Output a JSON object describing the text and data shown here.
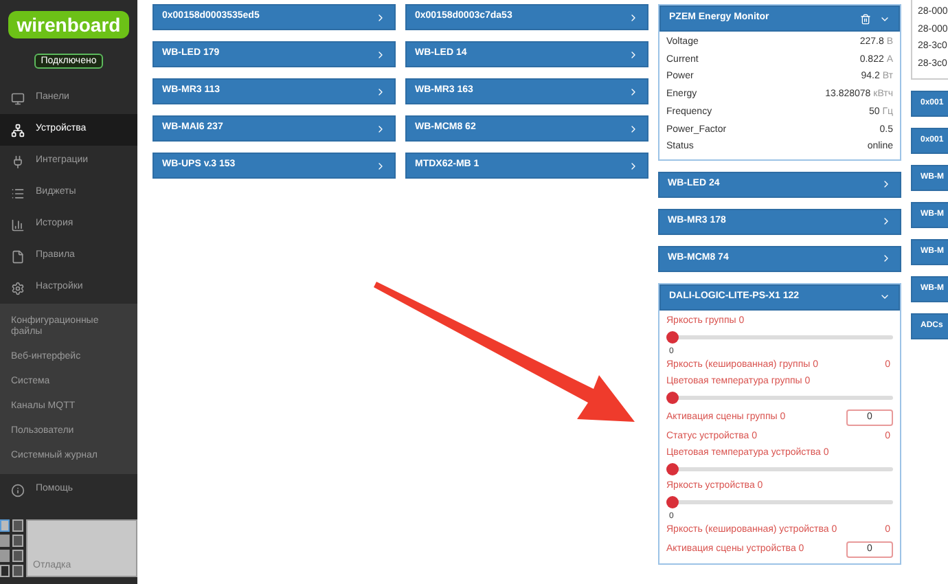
{
  "sidebar": {
    "logo": "wirenboard",
    "status": "Подключено",
    "items": [
      {
        "label": "Панели",
        "selected": false
      },
      {
        "label": "Устройства",
        "selected": true
      },
      {
        "label": "Интеграции",
        "selected": false
      },
      {
        "label": "Виджеты",
        "selected": false
      },
      {
        "label": "История",
        "selected": false
      },
      {
        "label": "Правила",
        "selected": false
      },
      {
        "label": "Настройки",
        "selected": false,
        "expanded": true,
        "children": [
          "Конфигурационные файлы",
          "Веб-интерфейс",
          "Система",
          "Каналы MQTT",
          "Пользователи",
          "Системный журнал"
        ]
      },
      {
        "label": "Помощь",
        "selected": false
      }
    ],
    "snap_label": "Отладка"
  },
  "columns": [
    {
      "devices": [
        {
          "title": "0x00158d0003535ed5",
          "expanded": false
        },
        {
          "title": "WB-LED 179",
          "expanded": false
        },
        {
          "title": "WB-MR3 113",
          "expanded": false
        },
        {
          "title": "WB-MAI6 237",
          "expanded": false
        },
        {
          "title": "WB-UPS v.3 153",
          "expanded": false
        }
      ]
    },
    {
      "devices": [
        {
          "title": "0x00158d0003c7da53",
          "expanded": false
        },
        {
          "title": "WB-LED 14",
          "expanded": false
        },
        {
          "title": "WB-MR3 163",
          "expanded": false
        },
        {
          "title": "WB-MCM8 62",
          "expanded": false
        },
        {
          "title": "MTDX62-MB 1",
          "expanded": false
        }
      ]
    },
    {
      "devices": [
        {
          "title": "PZEM Energy Monitor",
          "expanded": true,
          "deletable": true,
          "controls": [
            {
              "kind": "reading",
              "label": "Voltage",
              "value": "227.8",
              "unit": "В"
            },
            {
              "kind": "reading",
              "label": "Current",
              "value": "0.822",
              "unit": "А"
            },
            {
              "kind": "reading",
              "label": "Power",
              "value": "94.2",
              "unit": "Вт"
            },
            {
              "kind": "reading",
              "label": "Energy",
              "value": "13.828078",
              "unit": "кВтч"
            },
            {
              "kind": "reading",
              "label": "Frequency",
              "value": "50",
              "unit": "Гц"
            },
            {
              "kind": "reading",
              "label": "Power_Factor",
              "value": "0.5"
            },
            {
              "kind": "reading",
              "label": "Status",
              "value": "online"
            }
          ]
        },
        {
          "title": "WB-LED 24",
          "expanded": false
        },
        {
          "title": "WB-MR3 178",
          "expanded": false
        },
        {
          "title": "WB-MCM8 74",
          "expanded": false
        },
        {
          "title": "DALI-LOGIC-LITE-PS-X1 122",
          "expanded": true,
          "deletable": false,
          "controls": [
            {
              "kind": "slider",
              "label": "Яркость группы 0",
              "level": 0,
              "reading": "0"
            },
            {
              "kind": "value",
              "label": "Яркость (кешированная) группы 0",
              "value": "0"
            },
            {
              "kind": "slider",
              "label": "Цветовая температура группы 0",
              "level": 0
            },
            {
              "kind": "input",
              "label": "Активация сцены группы 0",
              "value": "0"
            },
            {
              "kind": "value",
              "label": "Статус устройства 0",
              "value": "0"
            },
            {
              "kind": "slider",
              "label": "Цветовая температура устройства 0",
              "level": 0
            },
            {
              "kind": "slider",
              "label": "Яркость устройства 0",
              "level": 0,
              "reading": "0"
            },
            {
              "kind": "value",
              "label": "Яркость (кешированная) устройства 0",
              "value": "0"
            },
            {
              "kind": "input",
              "label": "Активация сцены устройства 0",
              "value": "0"
            }
          ]
        }
      ]
    },
    {
      "list": [
        "28-000",
        "28-000",
        "28-3c0",
        "28-3c0"
      ],
      "devices": [
        {
          "title": "0x001",
          "expanded": false
        },
        {
          "title": "0x001",
          "expanded": false
        },
        {
          "title": "WB-M",
          "expanded": false
        },
        {
          "title": "WB-M",
          "expanded": false
        },
        {
          "title": "WB-M",
          "expanded": false
        },
        {
          "title": "WB-M",
          "expanded": false
        },
        {
          "title": "ADCs",
          "expanded": false
        }
      ]
    }
  ]
}
